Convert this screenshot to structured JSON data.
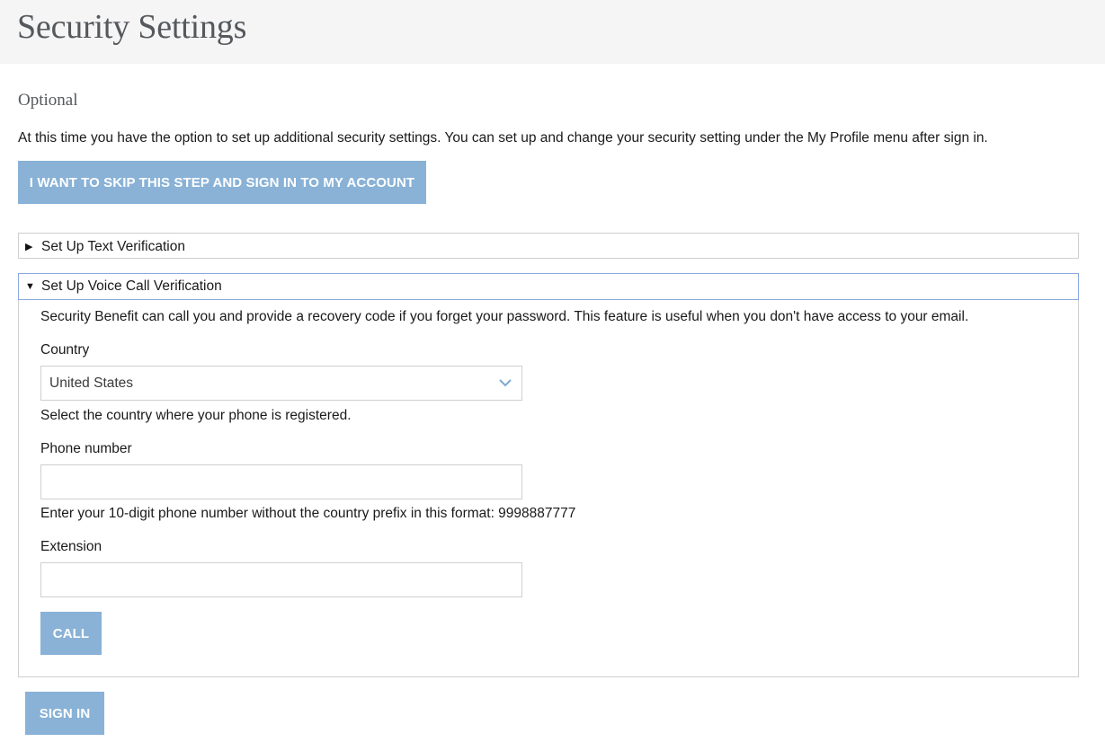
{
  "header": {
    "title": "Security Settings"
  },
  "intro": {
    "section_label": "Optional",
    "description": "At this time you have the option to set up additional security settings. You can set up and change your security setting under the My Profile menu after sign in."
  },
  "skip_button": {
    "label": "I WANT TO SKIP THIS STEP AND SIGN IN TO MY ACCOUNT"
  },
  "text_verification": {
    "title": "Set Up Text Verification",
    "expanded": false
  },
  "voice_verification": {
    "title": "Set Up Voice Call Verification",
    "expanded": true,
    "description": "Security Benefit can call you and provide a recovery code if you forget your password. This feature is useful when you don't have access to your email.",
    "country": {
      "label": "Country",
      "selected": "United States",
      "help": "Select the country where your phone is registered."
    },
    "phone": {
      "label": "Phone number",
      "value": "",
      "help": "Enter your 10-digit phone number without the country prefix in this format: 9998887777"
    },
    "extension": {
      "label": "Extension",
      "value": ""
    },
    "call_button": {
      "label": "CALL"
    }
  },
  "signin_button": {
    "label": "SIGN IN"
  },
  "colors": {
    "button_bg": "#89b2d6",
    "header_bg": "#f5f5f5",
    "title_text": "#55585c",
    "focus_border": "#8aa9e0"
  }
}
